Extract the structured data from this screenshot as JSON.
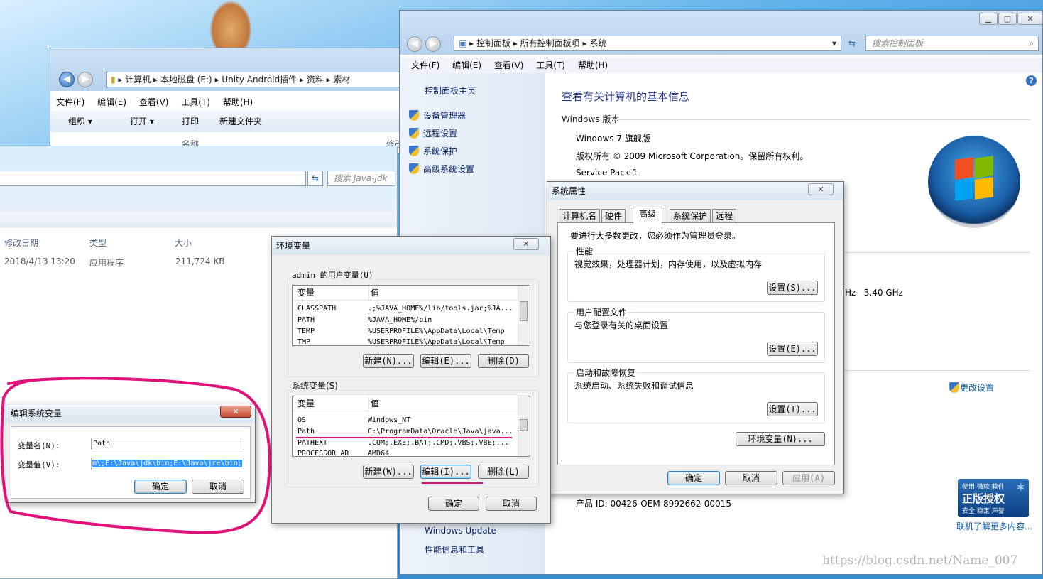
{
  "explorer": {
    "breadcrumb": [
      "计算机",
      "本地磁盘 (E:)",
      "Unity-Android插件",
      "资料",
      "素材"
    ],
    "menu": [
      "文件(F)",
      "编辑(E)",
      "查看(V)",
      "工具(T)",
      "帮助(H)"
    ],
    "toolbar": [
      "组织 ▾",
      "打开 ▾",
      "打印",
      "新建文件夹"
    ],
    "col_name": "名称",
    "col_modified_trunc": "修改"
  },
  "explorer2": {
    "search_placeholder": "搜索 Java-jdk",
    "columns": [
      "修改日期",
      "类型",
      "大小"
    ],
    "row": {
      "date": "2018/4/13 13:20",
      "type": "应用程序",
      "size": "211,724 KB"
    }
  },
  "control_panel": {
    "breadcrumb": [
      "控制面板",
      "所有控制面板项",
      "系统"
    ],
    "search_placeholder": "搜索控制面板",
    "menu": [
      "文件(F)",
      "编辑(E)",
      "查看(V)",
      "工具(T)",
      "帮助(H)"
    ],
    "sidebar_home": "控制面板主页",
    "sidebar_links": [
      "设备管理器",
      "远程设置",
      "系统保护",
      "高级系统设置"
    ],
    "sidebar_bottom": [
      "Windows Update",
      "性能信息和工具"
    ],
    "heading": "查看有关计算机的基本信息",
    "edition_header": "Windows 版本",
    "edition": "Windows 7 旗舰版",
    "copyright": "版权所有 © 2009 Microsoft Corporation。保留所有权利。",
    "service_pack": "Service Pack 1",
    "cpu_speed": "Hz   3.40 GHz",
    "change_settings": "更改设置",
    "product_id": "产品 ID: 00426-OEM-8992662-00015",
    "genuine_line1": "使用 微软 软件",
    "genuine_title": "正版授权",
    "genuine_line2": "安全 稳定 声誉",
    "learn_more": "联机了解更多内容..."
  },
  "sys_props": {
    "title": "系统属性",
    "tabs": [
      "计算机名",
      "硬件",
      "高级",
      "系统保护",
      "远程"
    ],
    "admin_note": "要进行大多数更改，您必须作为管理员登录。",
    "sections": [
      {
        "title": "性能",
        "desc": "视觉效果，处理器计划，内存使用，以及虚拟内存",
        "button": "设置(S)..."
      },
      {
        "title": "用户配置文件",
        "desc": "与您登录有关的桌面设置",
        "button": "设置(E)..."
      },
      {
        "title": "启动和故障恢复",
        "desc": "系统启动、系统失败和调试信息",
        "button": "设置(T)..."
      }
    ],
    "env_button": "环境变量(N)...",
    "ok": "确定",
    "cancel": "取消",
    "apply": "应用(A)"
  },
  "env_vars": {
    "title": "环境变量",
    "user_group": "admin 的用户变量(U)",
    "col_var": "变量",
    "col_val": "值",
    "user_rows": [
      {
        "name": "CLASSPATH",
        "value": ".;%JAVA_HOME%/lib/tools.jar;%JA..."
      },
      {
        "name": "PATH",
        "value": "%JAVA_HOME%/bin"
      },
      {
        "name": "TEMP",
        "value": "%USERPROFILE%\\AppData\\Local\\Temp"
      },
      {
        "name": "TMP",
        "value": "%USERPROFILE%\\AppData\\Local\\Temp"
      }
    ],
    "user_buttons": [
      "新建(N)...",
      "编辑(E)...",
      "删除(D)"
    ],
    "sys_group": "系统变量(S)",
    "sys_rows": [
      {
        "name": "OS",
        "value": "Windows_NT"
      },
      {
        "name": "Path",
        "value": "C:\\ProgramData\\Oracle\\Java\\java..."
      },
      {
        "name": "PATHEXT",
        "value": ".COM;.EXE;.BAT;.CMD;.VBS;.VBE;..."
      },
      {
        "name": "PROCESSOR_AR",
        "value": "AMD64"
      }
    ],
    "sys_buttons": [
      "新建(W)...",
      "编辑(I)...",
      "删除(L)"
    ],
    "ok": "确定",
    "cancel": "取消"
  },
  "edit_var": {
    "title": "编辑系统变量",
    "name_label": "变量名(N):",
    "name_value": "Path",
    "value_label": "变量值(V):",
    "value_value": "m\\;E:\\Java\\jdk\\bin;E:\\Java\\jre\\bin;",
    "ok": "确定",
    "cancel": "取消"
  },
  "watermark": "https://blog.csdn.net/Name_007",
  "colors": {
    "highlight": "#e0127a",
    "link": "#0a246a",
    "heading": "#1e3287"
  }
}
